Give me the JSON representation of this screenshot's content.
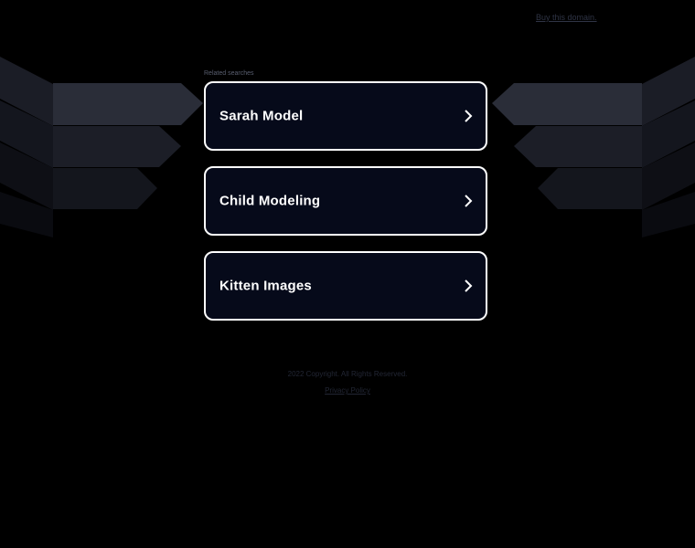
{
  "header": {
    "buy_domain_link": "Buy this domain."
  },
  "related": {
    "label": "Related searches",
    "items": [
      {
        "label": "Sarah Model"
      },
      {
        "label": "Child Modeling"
      },
      {
        "label": "Kitten Images"
      }
    ]
  },
  "footer": {
    "copyright": "2022 Copyright. All Rights Reserved.",
    "privacy": "Privacy Policy"
  },
  "colors": {
    "background": "#000000",
    "card_background": "#060a1a",
    "card_border": "#ffffff",
    "wing_light": "#2a2d38",
    "wing_dark": "#14161e"
  },
  "icons": {
    "card_arrow": "chevron-right-icon"
  }
}
